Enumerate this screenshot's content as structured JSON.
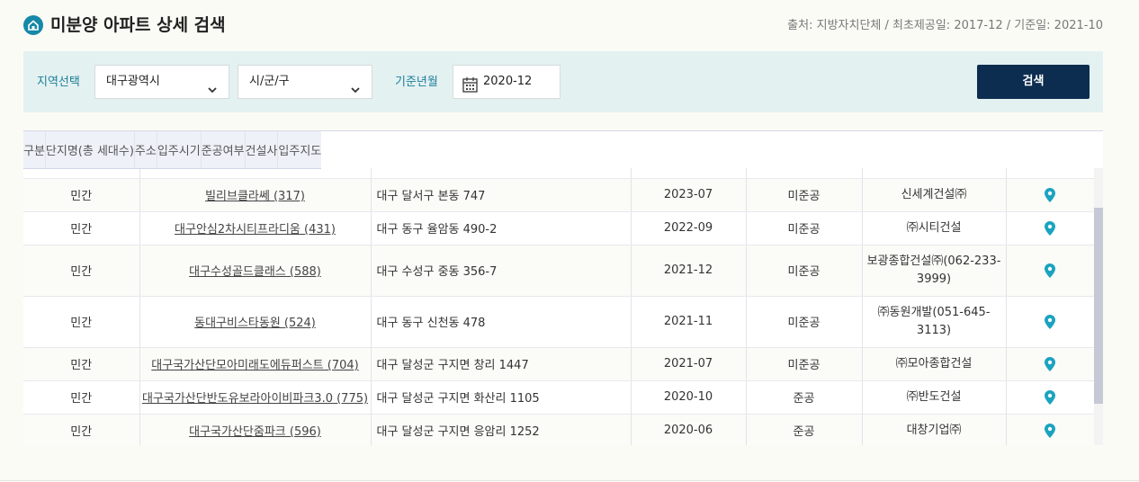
{
  "header": {
    "title": "미분양 아파트 상세 검색",
    "source": "출처: 지방자치단체 / 최초제공일: 2017-12 / 기준일: 2021-10"
  },
  "filters": {
    "region_label": "지역선택",
    "region_value": "대구광역시",
    "district_value": "시/군/구",
    "date_label": "기준년월",
    "date_value": "2020-12",
    "search_label": "검색"
  },
  "table": {
    "columns": [
      "구분",
      "단지명(총 세대수)",
      "주소",
      "입주시기",
      "준공여부",
      "건설사",
      "입주지도"
    ],
    "rows": [
      {
        "type": "민간",
        "name": "빌리브클라쎄 (317)",
        "addr": "대구 달서구 본동 747",
        "date": "2023-07",
        "status": "미준공",
        "builder": "신세계건설㈜"
      },
      {
        "type": "민간",
        "name": "대구안심2차시티프라디움 (431)",
        "addr": "대구 동구 율암동 490-2",
        "date": "2022-09",
        "status": "미준공",
        "builder": "㈜시티건설"
      },
      {
        "type": "민간",
        "name": "대구수성골드클래스 (588)",
        "addr": "대구 수성구 중동 356-7",
        "date": "2021-12",
        "status": "미준공",
        "builder": "보광종합건설㈜(062-233-3999)"
      },
      {
        "type": "민간",
        "name": "동대구비스타동원 (524)",
        "addr": "대구 동구 신천동 478",
        "date": "2021-11",
        "status": "미준공",
        "builder": "㈜동원개발(051-645-3113)"
      },
      {
        "type": "민간",
        "name": "대구국가산단모아미래도에듀퍼스트 (704)",
        "addr": "대구 달성군 구지면 창리 1447",
        "date": "2021-07",
        "status": "미준공",
        "builder": "㈜모아종합건설"
      },
      {
        "type": "민간",
        "name": "대구국가산단반도유보라아이비파크3.0 (775)",
        "addr": "대구 달성군 구지면 화산리 1105",
        "date": "2020-10",
        "status": "준공",
        "builder": "㈜반도건설"
      },
      {
        "type": "민간",
        "name": "대구국가산단줌파크 (596)",
        "addr": "대구 달성군 구지면 응암리 1252",
        "date": "2020-06",
        "status": "준공",
        "builder": "대창기업㈜"
      }
    ]
  },
  "colors": {
    "accent": "#1b7f9a",
    "pin": "#1aa3c0",
    "button": "#0c2d50",
    "filter_bg": "#e4f1f1"
  }
}
